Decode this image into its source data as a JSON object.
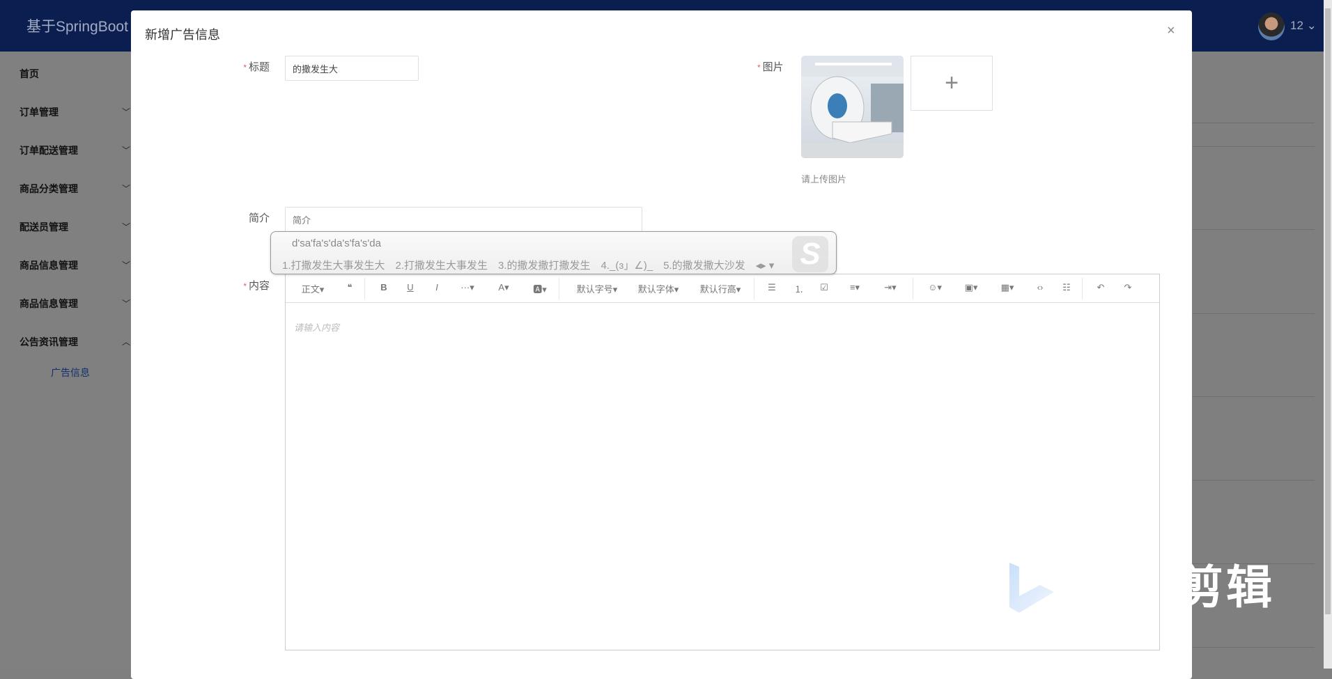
{
  "header": {
    "app_title": "基于SpringBoot",
    "user": "12 ⌄"
  },
  "sidebar": {
    "items": [
      {
        "label": "首页",
        "expandable": false
      },
      {
        "label": "订单管理",
        "expandable": true
      },
      {
        "label": "订单配送管理",
        "expandable": true
      },
      {
        "label": "商品分类管理",
        "expandable": true
      },
      {
        "label": "配送员管理",
        "expandable": true
      },
      {
        "label": "商品信息管理",
        "expandable": true
      },
      {
        "label": "商品信息管理",
        "expandable": true
      },
      {
        "label": "公告资讯管理",
        "expandable": true,
        "expanded": true
      }
    ],
    "sub_item": "广告信息"
  },
  "modal": {
    "title": "新增广告信息",
    "close": "×",
    "fields": {
      "title_label": "标题",
      "title_value": "的撒发生大",
      "image_label": "图片",
      "upload_plus": "+",
      "upload_hint": "请上传图片",
      "intro_label": "简介",
      "intro_placeholder": "简介",
      "content_label": "内容",
      "content_placeholder": "请输入内容",
      "required_mark": "*"
    },
    "toolbar": [
      "正文▾",
      "❝",
      "B",
      "U",
      "I",
      "···▾",
      "A▾",
      "🅰▾",
      "默认字号▾",
      "默认字体▾",
      "默认行高▾",
      "☰",
      "⒈",
      "☑",
      "≡▾",
      "⇥▾",
      "☺▾",
      "▣▾",
      "▦▾",
      "‹›",
      "☷",
      "↶",
      "↷"
    ]
  },
  "ime": {
    "input": "d'sa'fa's'da's'fa's'da",
    "candidates": [
      "1.打撒发生大事发生大",
      "2.打撒发生大事发生",
      "3.的撒发撒打撒发生",
      "4._(ɜ」∠)_",
      "5.的撒发撒大沙发"
    ],
    "more": "◂▸ ▾",
    "logo": "S"
  },
  "watermark": {
    "text": "剪辑"
  },
  "colors": {
    "header": "#0a1e50",
    "accent": "#12306e",
    "required": "#e06060"
  }
}
